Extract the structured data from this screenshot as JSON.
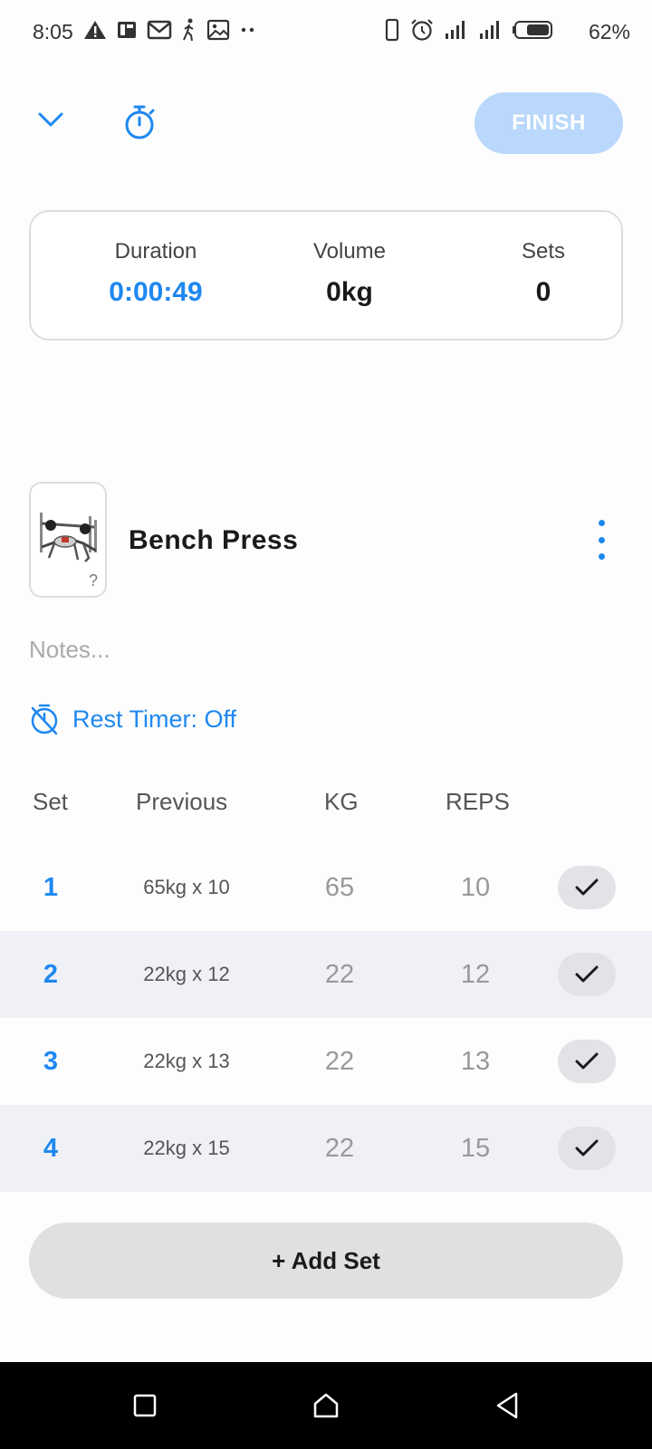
{
  "status_bar": {
    "time": "8:05",
    "battery": "62%",
    "left_icons": [
      "warning-icon",
      "pdf-icon",
      "gmail-icon",
      "walk-icon",
      "gallery-icon",
      "more-dots-icon"
    ],
    "right_icons": [
      "vibrate-icon",
      "alarm-icon",
      "signal-icon",
      "signal-icon",
      "battery-icon"
    ]
  },
  "header": {
    "finish_label": "FINISH"
  },
  "summary": {
    "duration_label": "Duration",
    "duration_value": "0:00:49",
    "volume_label": "Volume",
    "volume_value": "0kg",
    "sets_label": "Sets",
    "sets_value": "0"
  },
  "exercise": {
    "name": "Bench Press",
    "thumb_badge": "?",
    "notes_placeholder": "Notes...",
    "rest_timer": "Rest Timer: Off"
  },
  "table": {
    "headers": {
      "set": "Set",
      "previous": "Previous",
      "kg": "KG",
      "reps": "REPS"
    },
    "rows": [
      {
        "set": "1",
        "previous": "65kg x 10",
        "kg": "65",
        "reps": "10"
      },
      {
        "set": "2",
        "previous": "22kg x 12",
        "kg": "22",
        "reps": "12"
      },
      {
        "set": "3",
        "previous": "22kg x 13",
        "kg": "22",
        "reps": "13"
      },
      {
        "set": "4",
        "previous": "22kg x 15",
        "kg": "22",
        "reps": "15"
      }
    ]
  },
  "add_set_label": "+ Add Set",
  "colors": {
    "accent": "#1e88f0",
    "finish_disabled": "#b9d8fb",
    "row_alt": "#f0f1f6",
    "add_set_bg": "#e0e0e2"
  }
}
